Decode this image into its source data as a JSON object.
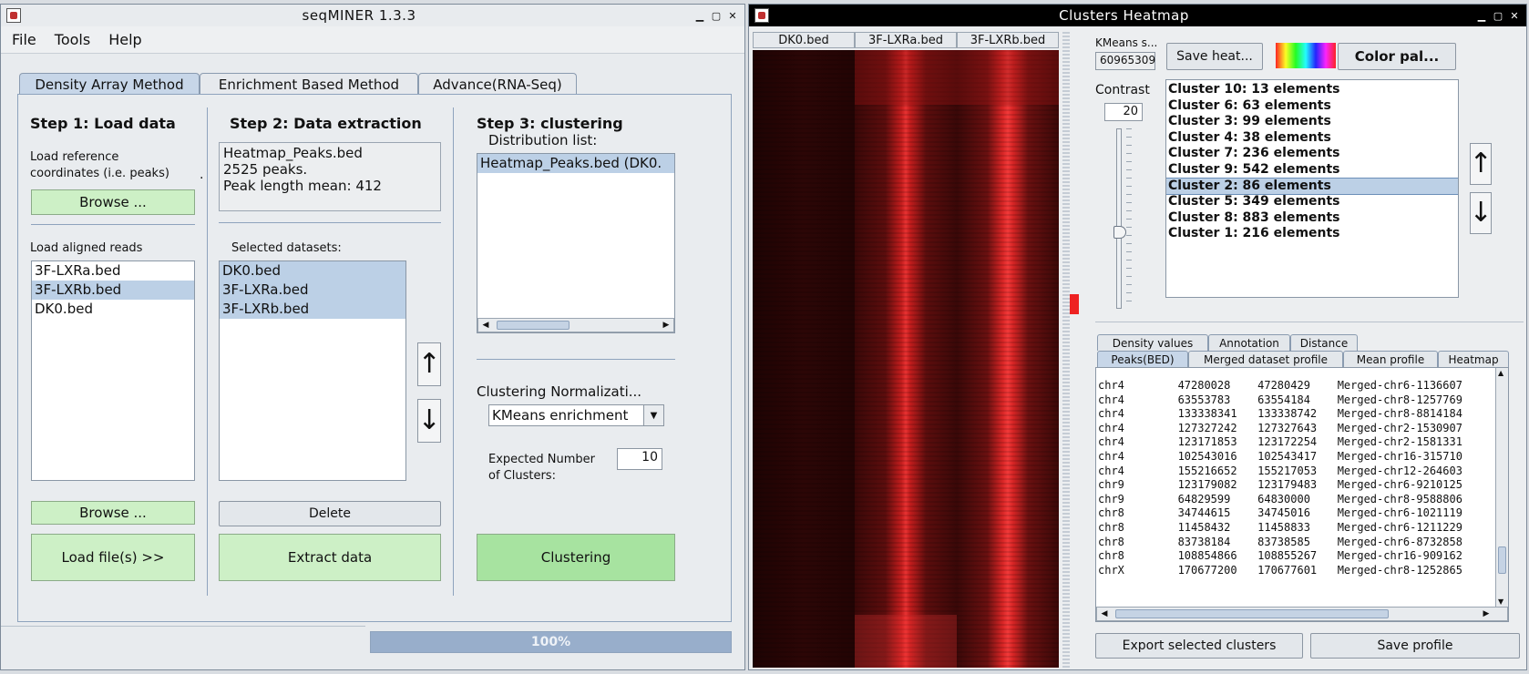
{
  "main_window": {
    "title": "seqMINER 1.3.3",
    "menu": [
      "File",
      "Tools",
      "Help"
    ],
    "tabs": [
      "Density Array Method",
      "Enrichment Based Method",
      "Advance(RNA-Seq)"
    ],
    "step1": {
      "title": "Step 1: Load data",
      "ref_label_line1": "Load reference",
      "ref_label_line2": "coordinates (i.e. peaks)",
      "browse_label": "Browse ...",
      "aligned_label": "Load aligned reads",
      "aligned_files": [
        "3F-LXRa.bed",
        "3F-LXRb.bed",
        "DK0.bed"
      ],
      "browse2_label": "Browse ...",
      "load_label": "Load file(s)  >>"
    },
    "step2": {
      "title": "Step 2: Data extraction",
      "info_line1": "Heatmap_Peaks.bed",
      "info_line2": "2525 peaks.",
      "info_line3": " Peak length mean: 412",
      "selected_label": "Selected datasets:",
      "datasets": [
        "DK0.bed",
        "3F-LXRa.bed",
        "3F-LXRb.bed"
      ],
      "delete_label": "Delete",
      "extract_label": "Extract data"
    },
    "step3": {
      "title": "Step 3: clustering",
      "dist_label": "Distribution list:",
      "dist_item": "Heatmap_Peaks.bed (DK0.",
      "norm_label": "Clustering Normalizati...",
      "norm_value": "KMeans enrichment",
      "expected_line1": "Expected Number",
      "expected_line2": "of Clusters:",
      "expected_value": "10",
      "cluster_label": "Clustering"
    },
    "progress": {
      "text": "100%",
      "value": 1.0
    }
  },
  "heatmap_window": {
    "title": "Clusters Heatmap",
    "columns": [
      "DK0.bed",
      "3F-LXRa.bed",
      "3F-LXRb.bed"
    ],
    "kmeans_label": "KMeans s...",
    "kmeans_value": "60965309",
    "save_heat_label": "Save heat...",
    "color_pal_label": "Color pal...",
    "contrast_label": "Contrast",
    "contrast_value": "20",
    "clusters": [
      "Cluster 10: 13 elements",
      "Cluster 6: 63 elements",
      "Cluster 3: 99 elements",
      "Cluster 4: 38 elements",
      "Cluster 7: 236 elements",
      "Cluster 9: 542 elements",
      "Cluster 2: 86 elements",
      "Cluster 5: 349 elements",
      "Cluster 8: 883 elements",
      "Cluster 1: 216 elements"
    ],
    "selected_cluster_index": 6,
    "subtabs_row1": [
      "Density values",
      "Annotation",
      "Distance"
    ],
    "subtabs_row2": [
      "Peaks(BED)",
      "Merged dataset profile",
      "Mean profile",
      "Heatmap"
    ],
    "peaks": [
      [
        "chr4",
        "47280028",
        "47280429",
        "Merged-chr6-1136607"
      ],
      [
        "chr4",
        "63553783",
        "63554184",
        "Merged-chr8-1257769"
      ],
      [
        "chr4",
        "133338341",
        "133338742",
        "Merged-chr8-8814184"
      ],
      [
        "chr4",
        "127327242",
        "127327643",
        "Merged-chr2-1530907"
      ],
      [
        "chr4",
        "123171853",
        "123172254",
        "Merged-chr2-1581331"
      ],
      [
        "chr4",
        "102543016",
        "102543417",
        "Merged-chr16-315710"
      ],
      [
        "chr4",
        "155216652",
        "155217053",
        "Merged-chr12-264603"
      ],
      [
        "chr9",
        "123179082",
        "123179483",
        "Merged-chr6-9210125"
      ],
      [
        "chr9",
        "64829599",
        "64830000",
        "Merged-chr8-9588806"
      ],
      [
        "chr8",
        "34744615",
        "34745016",
        "Merged-chr6-1021119"
      ],
      [
        "chr8",
        "11458432",
        "11458833",
        "Merged-chr6-1211229"
      ],
      [
        "chr8",
        "83738184",
        "83738585",
        "Merged-chr6-8732858"
      ],
      [
        "chr8",
        "108854866",
        "108855267",
        "Merged-chr16-909162"
      ],
      [
        "chrX",
        "170677200",
        "170677601",
        "Merged-chr8-1252865"
      ]
    ],
    "export_label": "Export selected clusters",
    "save_profile_label": "Save profile"
  }
}
